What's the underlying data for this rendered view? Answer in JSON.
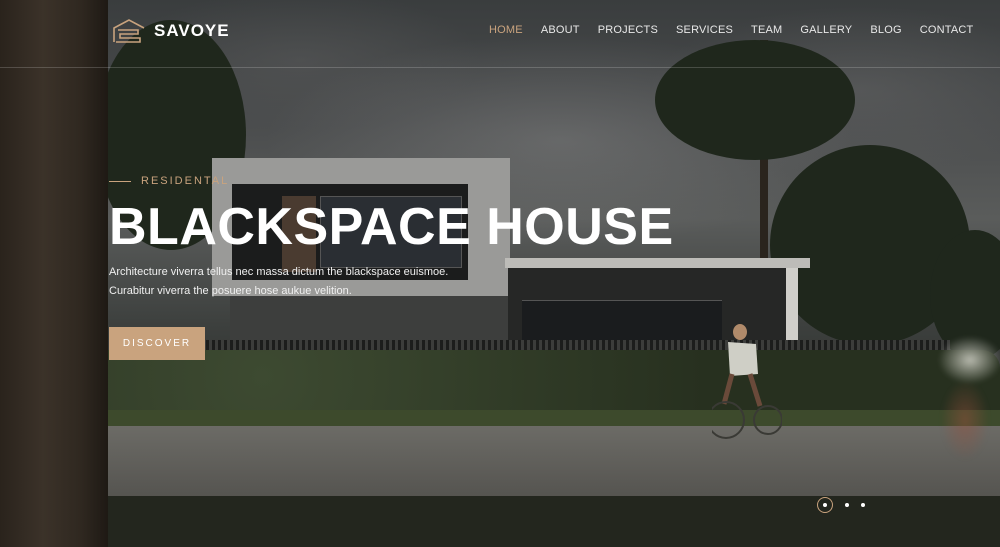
{
  "brand": {
    "name": "SAVOYE",
    "logo_icon": "logo-mark-icon"
  },
  "nav": {
    "items": [
      {
        "label": "HOME",
        "active": true
      },
      {
        "label": "ABOUT",
        "active": false
      },
      {
        "label": "PROJECTS",
        "active": false
      },
      {
        "label": "SERVICES",
        "active": false
      },
      {
        "label": "TEAM",
        "active": false
      },
      {
        "label": "GALLERY",
        "active": false
      },
      {
        "label": "BLOG",
        "active": false
      },
      {
        "label": "CONTACT",
        "active": false
      }
    ]
  },
  "hero": {
    "subtitle": "RESIDENTAL",
    "title": "BLACKSPACE HOUSE",
    "description_line1": "Architecture viverra tellus nec massa dictum the blackspace euismoe.",
    "description_line2": "Curabitur viverra the posuere hose aukue velition.",
    "button_label": "DISCOVER"
  },
  "slider": {
    "total_slides": 3,
    "active_slide": 1
  },
  "colors": {
    "accent": "#c9a37e",
    "text": "#ffffff"
  }
}
